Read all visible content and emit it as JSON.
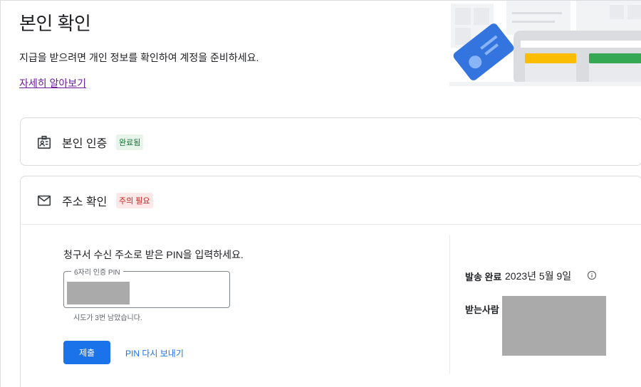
{
  "header": {
    "title": "본인 확인",
    "subtitle": "지급을 받으려면 개인 정보를 확인하여 계정을 준비하세요.",
    "learn_more": "자세히 알아보기"
  },
  "identity_card": {
    "title": "본인 인증",
    "status": "완료됨",
    "icon": "id-badge-icon"
  },
  "address_card": {
    "title": "주소 확인",
    "status": "주의 필요",
    "icon": "mail-icon",
    "pin_prompt": "청구서 수신 주소로 받은 PIN을 입력하세요.",
    "pin_field_label": "6자리 인증 PIN",
    "attempts_text": "시도가 3번 남았습니다.",
    "submit_label": "제출",
    "resend_label": "PIN 다시 보내기",
    "sent_label": "발송 완료",
    "sent_date": "2023년 5월 9일",
    "recipient_label": "받는사람"
  },
  "colors": {
    "primary": "#1a73e8",
    "success_bg": "#e6f4ea",
    "success_text": "#137333",
    "warn_bg": "#fce8e6",
    "warn_text": "#c5221f",
    "link_visited": "#6a1b9a"
  }
}
